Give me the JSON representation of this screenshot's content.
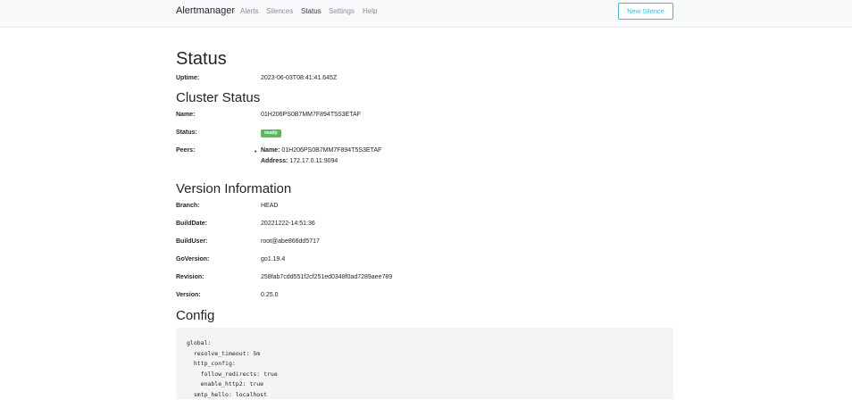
{
  "navbar": {
    "brand": "Alertmanager",
    "links": [
      "Alerts",
      "Silences",
      "Status",
      "Settings",
      "Help"
    ],
    "new_silence_label": "New Silence"
  },
  "status": {
    "title": "Status",
    "uptime_label": "Uptime:",
    "uptime": "2023-06-03T08:41:41.645Z"
  },
  "cluster": {
    "title": "Cluster Status",
    "name_label": "Name:",
    "name": "01H206PS0B7MM7F894T5S3ETAF",
    "status_label": "Status:",
    "status_badge": "ready",
    "peers_label": "Peers:",
    "peers": [
      {
        "name_label": "Name:",
        "name": "01H206PS0B7MM7F894T5S3ETAF",
        "address_label": "Address:",
        "address": "172.17.0.11:9094"
      }
    ]
  },
  "version": {
    "title": "Version Information",
    "rows": [
      {
        "label": "Branch:",
        "value": "HEAD"
      },
      {
        "label": "BuildDate:",
        "value": "20221222-14:51:36"
      },
      {
        "label": "BuildUser:",
        "value": "root@abe866dd5717"
      },
      {
        "label": "GoVersion:",
        "value": "go1.19.4"
      },
      {
        "label": "Revision:",
        "value": "258fab7cdd551f2cf251ed0348f0ad7289aee789"
      },
      {
        "label": "Version:",
        "value": "0.25.0"
      }
    ]
  },
  "config": {
    "title": "Config",
    "text": "global:\n  resolve_timeout: 5m\n  http_config:\n    follow_redirects: true\n    enable_http2: true\n  smtp_hello: localhost"
  },
  "colors": {
    "accent": "#49b8d0",
    "badge_green": "#5cb85c",
    "navbar_bg": "#f8f9fa",
    "config_bg": "#f4f4f4"
  }
}
